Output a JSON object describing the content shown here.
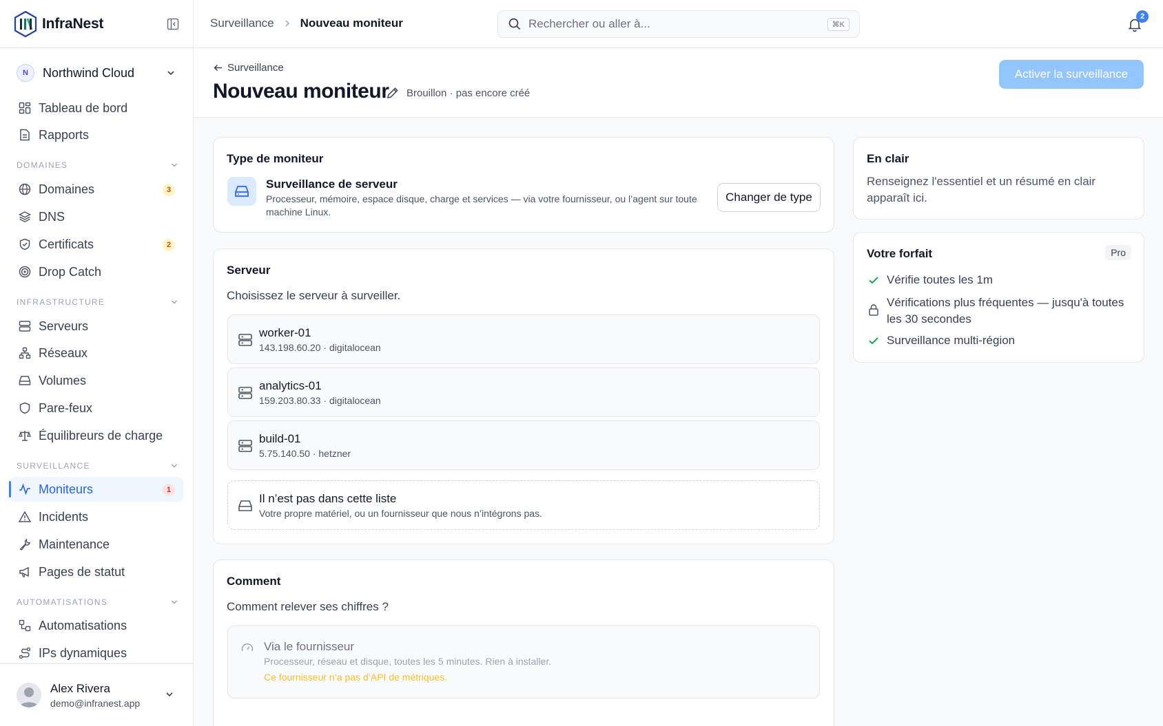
{
  "brand": {
    "name": "InfraNest"
  },
  "org": {
    "initial": "N",
    "name": "Northwind Cloud"
  },
  "nav": {
    "dashboard": "Tableau de bord",
    "reports": "Rapports",
    "sec_domains": "DOMAINES",
    "domains": "Domaines",
    "domains_badge": "3",
    "dns": "DNS",
    "certificates": "Certificats",
    "certificates_badge": "2",
    "dropcatch": "Drop Catch",
    "sec_infra": "INFRASTRUCTURE",
    "servers": "Serveurs",
    "networks": "Réseaux",
    "volumes": "Volumes",
    "firewalls": "Pare-feux",
    "lb": "Équilibreurs de charge",
    "sec_monitoring": "SURVEILLANCE",
    "monitors": "Moniteurs",
    "monitors_badge": "1",
    "incidents": "Incidents",
    "maintenance": "Maintenance",
    "statuspages": "Pages de statut",
    "sec_auto": "AUTOMATISATIONS",
    "automations": "Automatisations",
    "dynips": "IPs dynamiques"
  },
  "user": {
    "name": "Alex Rivera",
    "email": "demo@infranest.app"
  },
  "topbar": {
    "crumb_parent": "Surveillance",
    "crumb_current": "Nouveau moniteur",
    "search_placeholder": "Rechercher ou aller à...",
    "search_kbd": "⌘K",
    "notif_count": "2"
  },
  "header": {
    "back": "Surveillance",
    "title": "Nouveau moniteur",
    "status": "Brouillon · pas encore créé",
    "activate": "Activer la surveillance"
  },
  "type_card": {
    "title": "Type de moniteur",
    "name": "Surveillance de serveur",
    "desc": "Processeur, mémoire, espace disque, charge et services — via votre fournisseur, ou l’agent sur toute machine Linux.",
    "change": "Changer de type"
  },
  "server_card": {
    "title": "Serveur",
    "subtitle": "Choisissez le serveur à surveiller.",
    "servers": [
      {
        "name": "worker-01",
        "meta": "143.198.60.20 · digitalocean"
      },
      {
        "name": "analytics-01",
        "meta": "159.203.80.33 · digitalocean"
      },
      {
        "name": "build-01",
        "meta": "5.75.140.50 · hetzner"
      }
    ],
    "other_name": "Il n’est pas dans cette liste",
    "other_desc": "Votre propre matériel, ou un fournisseur que nous n’intégrons pas."
  },
  "how_card": {
    "title": "Comment",
    "subtitle": "Comment relever ses chiffres ?",
    "opt1_name": "Via le fournisseur",
    "opt1_desc": "Processeur, réseau et disque, toutes les 5 minutes. Rien à installer.",
    "opt1_warn": "Ce fournisseur n’a pas d’API de métriques."
  },
  "plain_card": {
    "title": "En clair",
    "text": "Renseignez l'essentiel et un résumé en clair apparaît ici."
  },
  "plan_card": {
    "title": "Votre forfait",
    "badge": "Pro",
    "items": [
      "Vérifie toutes les 1m",
      "Vérifications plus fréquentes — jusqu'à toutes les 30 secondes",
      "Surveillance multi-région"
    ]
  },
  "colors": {
    "accent": "#3b82f6",
    "accent_light": "#93c5fd",
    "check": "#16a34a",
    "warn": "#fbbf24"
  }
}
